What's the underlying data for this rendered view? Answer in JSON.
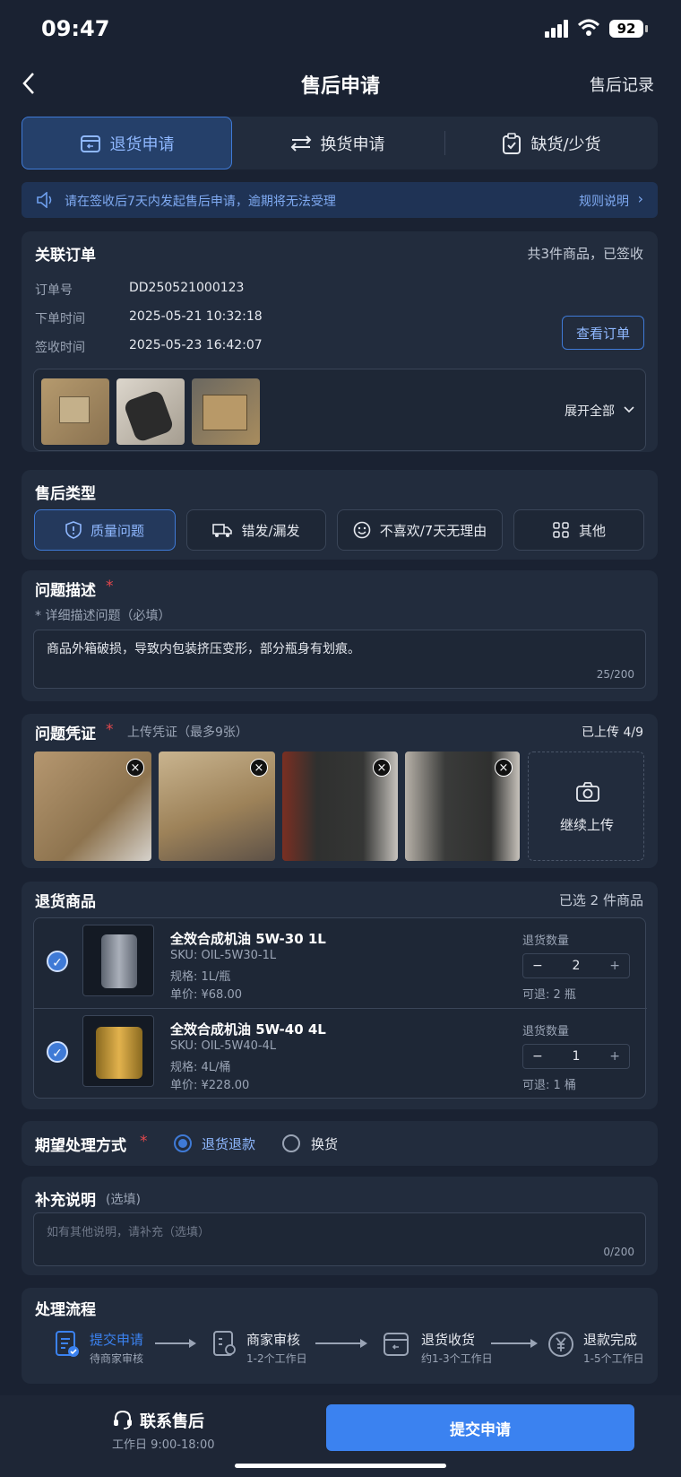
{
  "status": {
    "time": "09:47",
    "battery": "92"
  },
  "nav": {
    "title": "售后申请",
    "right": "售后记录"
  },
  "tabs": [
    {
      "label": "退货申请",
      "active": true
    },
    {
      "label": "换货申请"
    },
    {
      "label": "缺货/少货"
    }
  ],
  "notice": {
    "text": "请在签收后7天内发起售后申请，逾期将无法受理",
    "link": "规则说明"
  },
  "order": {
    "title": "关联订单",
    "summary": "共3件商品，已签收",
    "fields": [
      {
        "label": "订单号",
        "value": "DD250521000123"
      },
      {
        "label": "下单时间",
        "value": "2025-05-21 10:32:18"
      },
      {
        "label": "签收时间",
        "value": "2025-05-23 16:42:07"
      }
    ],
    "view_button": "查看订单",
    "expand": "展开全部"
  },
  "type": {
    "title": "售后类型",
    "options": [
      "质量问题",
      "错发/漏发",
      "不喜欢/7天无理由",
      "其他"
    ],
    "selected": "质量问题"
  },
  "desc": {
    "title": "问题描述",
    "required": "*",
    "hint": "* 详细描述问题（必填）",
    "value": "商品外箱破损，导致内包装挤压变形，部分瓶身有划痕。",
    "count": "25/200"
  },
  "evidence": {
    "title": "问题凭证",
    "required": "*",
    "hint": "上传凭证（最多9张）",
    "status": "已上传 4/9",
    "upload": "继续上传"
  },
  "items": {
    "title": "退货商品",
    "summary": "已选 2 件商品",
    "list": [
      {
        "name": "全效合成机油 5W-30 1L",
        "sku": "SKU:  OIL-5W30-1L",
        "spec": "规格:  1L/瓶",
        "price": "单价:  ¥68.00",
        "qty_label": "退货数量",
        "qty": "2",
        "avail": "可退:  2 瓶"
      },
      {
        "name": "全效合成机油 5W-40 4L",
        "sku": "SKU:  OIL-5W40-4L",
        "spec": "规格:  4L/桶",
        "price": "单价:  ¥228.00",
        "qty_label": "退货数量",
        "qty": "1",
        "avail": "可退:  1 桶"
      }
    ]
  },
  "method": {
    "title": "期望处理方式",
    "required": "*",
    "options": [
      "退货退款",
      "换货"
    ],
    "selected": "退货退款"
  },
  "extra": {
    "title": "补充说明",
    "optional": "(选填)",
    "placeholder": "如有其他说明，请补充（选填）",
    "count": "0/200"
  },
  "flow": {
    "title": "处理流程",
    "steps": [
      {
        "title": "提交申请",
        "sub": "待商家审核",
        "active": true
      },
      {
        "title": "商家审核",
        "sub": "1-2个工作日"
      },
      {
        "title": "退货收货",
        "sub": "约1-3个工作日"
      },
      {
        "title": "退款完成",
        "sub": "1-5个工作日"
      }
    ]
  },
  "bottom": {
    "contact": "联系售后",
    "hours": "工作日 9:00-18:00",
    "submit": "提交申请"
  },
  "colors": {
    "accent": "#3b82f0",
    "bg": "#1a2232",
    "card": "#222c3d"
  }
}
